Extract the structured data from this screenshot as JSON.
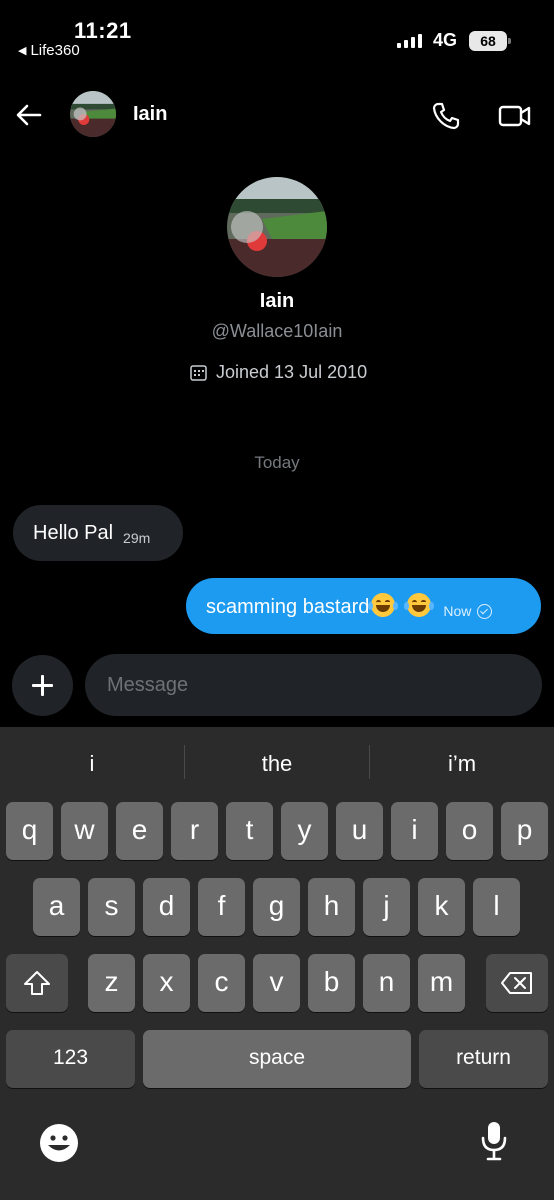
{
  "status_bar": {
    "time": "11:21",
    "back_app": "Life360",
    "network": "4G",
    "battery": "68"
  },
  "header": {
    "contact_name": "Iain"
  },
  "profile": {
    "name": "Iain",
    "handle": "@Wallace10Iain",
    "joined": "Joined 13 Jul 2010"
  },
  "conversation": {
    "date_divider": "Today",
    "messages": [
      {
        "direction": "incoming",
        "text": "Hello Pal",
        "time": "29m"
      },
      {
        "direction": "outgoing",
        "text": "scamming bastard",
        "emoji": "face-with-tears-of-joy x2",
        "time": "Now",
        "status": "sent"
      }
    ]
  },
  "composer": {
    "placeholder": "Message"
  },
  "keyboard": {
    "suggestions": [
      "i",
      "the",
      "i’m"
    ],
    "row1": [
      "q",
      "w",
      "e",
      "r",
      "t",
      "y",
      "u",
      "i",
      "o",
      "p"
    ],
    "row2": [
      "a",
      "s",
      "d",
      "f",
      "g",
      "h",
      "j",
      "k",
      "l"
    ],
    "row3": [
      "z",
      "x",
      "c",
      "v",
      "b",
      "n",
      "m"
    ],
    "numbers_label": "123",
    "space_label": "space",
    "return_label": "return"
  },
  "colors": {
    "background": "#000000",
    "accent_blue": "#1d9bf0",
    "bubble_gray": "#202327",
    "keyboard_bg": "#2b2b2b",
    "key_bg": "#6b6b6b"
  }
}
